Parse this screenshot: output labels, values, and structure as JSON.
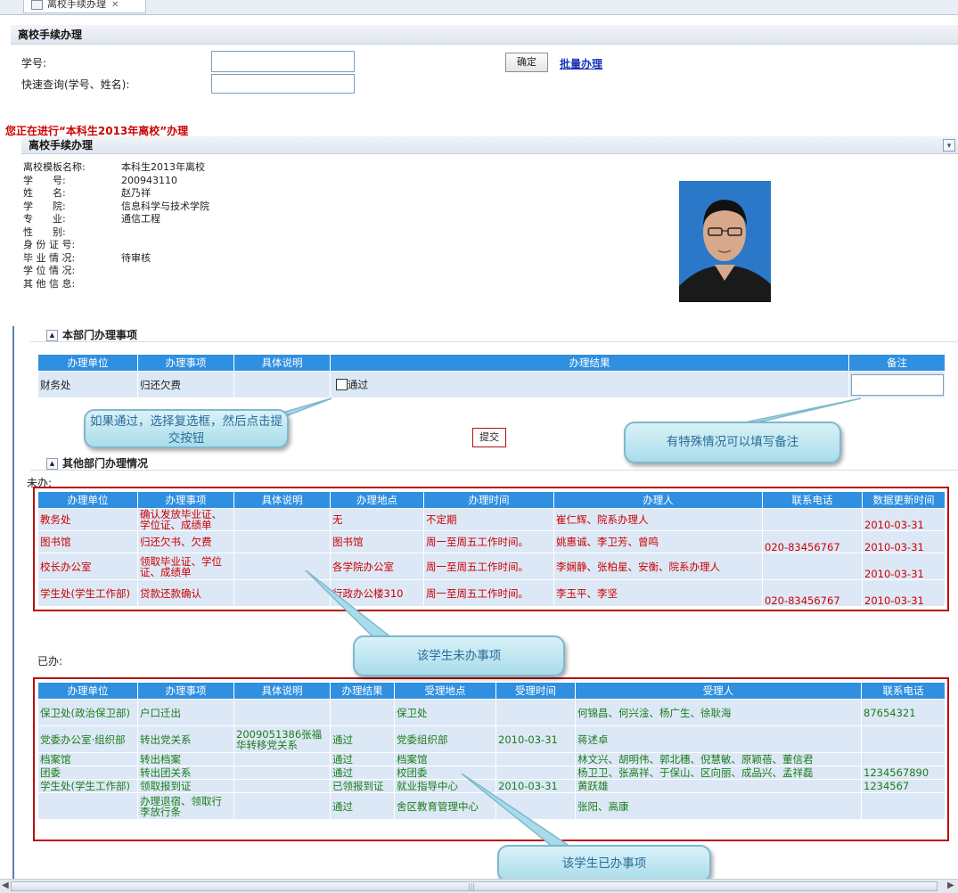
{
  "tab": {
    "label": "离校手续办理"
  },
  "query": {
    "title": "离校手续办理",
    "student_no_label": "学号:",
    "student_no_value": "",
    "quick_label": "快速查询(学号、姓名):",
    "quick_value": "",
    "confirm_label": "确定",
    "batch_label": "批量办理"
  },
  "notice": "您正在进行“本科生2013年离校”办理",
  "panel": {
    "title": "离校手续办理"
  },
  "student": {
    "fields": [
      {
        "label": "离校模板名称:",
        "value": "本科生2013年离校"
      },
      {
        "label": "学　　号:",
        "value": "200943110"
      },
      {
        "label": "姓　　名:",
        "value": "赵乃祥"
      },
      {
        "label": "学　　院:",
        "value": "信息科学与技术学院"
      },
      {
        "label": "专　　业:",
        "value": "通信工程"
      },
      {
        "label": "性　　别:",
        "value": ""
      },
      {
        "label": "身 份 证 号:",
        "value": ""
      },
      {
        "label": "毕 业 情 况:",
        "value": "待审核"
      },
      {
        "label": "学 位 情 况:",
        "value": ""
      },
      {
        "label": "其 他 信 息:",
        "value": ""
      }
    ]
  },
  "dept_section": {
    "title": "本部门办理事项",
    "headers": [
      "办理单位",
      "办理事项",
      "具体说明",
      "办理结果",
      "备注"
    ],
    "row": {
      "unit": "财务处",
      "item": "归还欠费",
      "desc": "",
      "pass_label": "通过",
      "remark": ""
    },
    "submit_label": "提交"
  },
  "other_section": {
    "title": "其他部门办理情况",
    "pending_label": "未办:",
    "pending_headers": [
      "办理单位",
      "办理事项",
      "具体说明",
      "办理地点",
      "办理时间",
      "办理人",
      "联系电话",
      "数据更新时间"
    ],
    "pending_rows": [
      {
        "unit": "教务处",
        "item": "确认发放毕业证、学位证、成绩单",
        "desc": "",
        "place": "无",
        "time": "不定期",
        "person": "崔仁辉、院系办理人",
        "phone": "",
        "updated": "2010-03-31"
      },
      {
        "unit": "图书馆",
        "item": "归还欠书、欠费",
        "desc": "",
        "place": "图书馆",
        "time": "周一至周五工作时间。",
        "person": "姚惠诚、李卫芳、曾鸣",
        "phone": "020-83456767",
        "updated": "2010-03-31"
      },
      {
        "unit": "校长办公室",
        "item": "领取毕业证、学位证、成绩单",
        "desc": "",
        "place": "各学院办公室",
        "time": "周一至周五工作时间。",
        "person": "李娴静、张柏星、安衡、院系办理人",
        "phone": "",
        "updated": "2010-03-31"
      },
      {
        "unit": "学生处(学生工作部)",
        "item": "贷款还款确认",
        "desc": "",
        "place": "行政办公楼310",
        "time": "周一至周五工作时间。",
        "person": "李玉平、李坚",
        "phone": "020-83456767",
        "updated": "2010-03-31"
      }
    ],
    "done_label": "已办:",
    "done_headers": [
      "办理单位",
      "办理事项",
      "具体说明",
      "办理结果",
      "受理地点",
      "受理时间",
      "受理人",
      "联系电话"
    ],
    "done_rows": [
      {
        "unit": "保卫处(政治保卫部)",
        "item": "户口迁出",
        "desc": "",
        "result": "",
        "place": "保卫处",
        "time": "",
        "person": "何锦昌、何兴淦、杨广生、徐耿海",
        "phone": "87654321"
      },
      {
        "unit": "党委办公室·组织部",
        "item": "转出党关系",
        "desc": "2009051386张福华转移党关系",
        "result": "通过",
        "place": "党委组织部",
        "time": "2010-03-31",
        "person": "蒋述卓",
        "phone": ""
      },
      {
        "unit": "档案馆",
        "item": "转出档案",
        "desc": "",
        "result": "通过",
        "place": "档案馆",
        "time": "",
        "person": "林文兴、胡明伟、郭北穗、倪慧敏、原颖蓓、董信君",
        "phone": ""
      },
      {
        "unit": "团委",
        "item": "转出团关系",
        "desc": "",
        "result": "通过",
        "place": "校团委",
        "time": "",
        "person": "杨卫卫、张高祥、于保山、区向丽、成品兴、孟祥磊",
        "phone": "1234567890"
      },
      {
        "unit": "学生处(学生工作部)",
        "item": "领取报到证",
        "desc": "",
        "result": "已领报到证",
        "place": "就业指导中心",
        "time": "2010-03-31",
        "person": "黄跃雄",
        "phone": "1234567"
      },
      {
        "unit": "",
        "item": "办理退宿、领取行李放行条",
        "desc": "",
        "result": "通过",
        "place": "舍区教育管理中心",
        "time": "",
        "person": "张阳、高康",
        "phone": ""
      }
    ]
  },
  "callouts": {
    "checkbox_tip": "如果通过，选择复选框，然后点击提交按钮",
    "remark_tip": "有特殊情况可以填写备注",
    "pending_tip": "该学生未办事项",
    "done_tip": "该学生已办事项"
  },
  "colors": {
    "header_blue": "#2f8fe0",
    "pending_red": "#cc0000",
    "done_green": "#1b7d1b",
    "highlight_box": "#b80e0e"
  }
}
